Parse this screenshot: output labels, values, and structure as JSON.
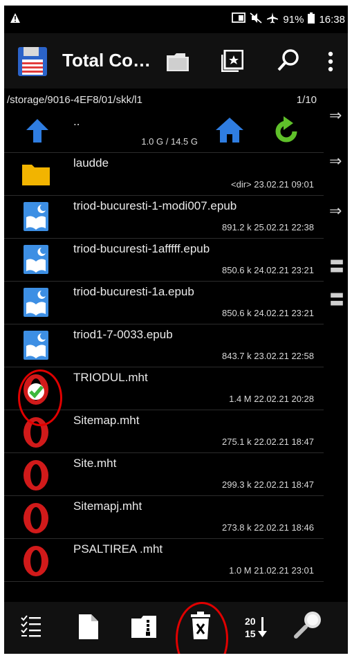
{
  "status_bar": {
    "battery": "91%",
    "time": "16:38"
  },
  "header": {
    "title": "Total Co…"
  },
  "path": {
    "current": "/storage/9016-4EF8/01/skk/l1",
    "page": "1/10"
  },
  "parent_row": {
    "name": "..",
    "meta": "1.0 G / 14.5 G"
  },
  "files": [
    {
      "name": "laudde",
      "meta": "<dir> 23.02.21 09:01",
      "type": "folder"
    },
    {
      "name": "triod-bucuresti-1-modi007.epub",
      "meta": "891.2 k 25.02.21 22:38",
      "type": "epub"
    },
    {
      "name": "triod-bucuresti-1afffff.epub",
      "meta": "850.6 k 24.02.21 23:21",
      "type": "epub"
    },
    {
      "name": "triod-bucuresti-1a.epub",
      "meta": "850.6 k 24.02.21 23:21",
      "type": "epub"
    },
    {
      "name": "triod1-7-0033.epub",
      "meta": "843.7 k 23.02.21 22:58",
      "type": "epub"
    },
    {
      "name": "TRIODUL.mht",
      "meta": "1.4 M 22.02.21 20:28",
      "type": "opera-checked"
    },
    {
      "name": "Sitemap.mht",
      "meta": "275.1 k 22.02.21 18:47",
      "type": "opera"
    },
    {
      "name": "Site.mht",
      "meta": "299.3 k 22.02.21 18:47",
      "type": "opera"
    },
    {
      "name": "Sitemapj.mht",
      "meta": "273.8 k 22.02.21 18:46",
      "type": "opera"
    },
    {
      "name": "PSALTIREA .mht",
      "meta": "1.0 M 21.02.21 23:01",
      "type": "opera"
    }
  ],
  "bottom_bar": {
    "sort_label_top": "20",
    "sort_label_bottom": "15"
  },
  "colors": {
    "accent_blue": "#2f7de1",
    "folder_yellow": "#f2b400",
    "opera_red": "#d11a1a",
    "refresh_green": "#5fc02a",
    "annotation_red": "#e00000"
  }
}
